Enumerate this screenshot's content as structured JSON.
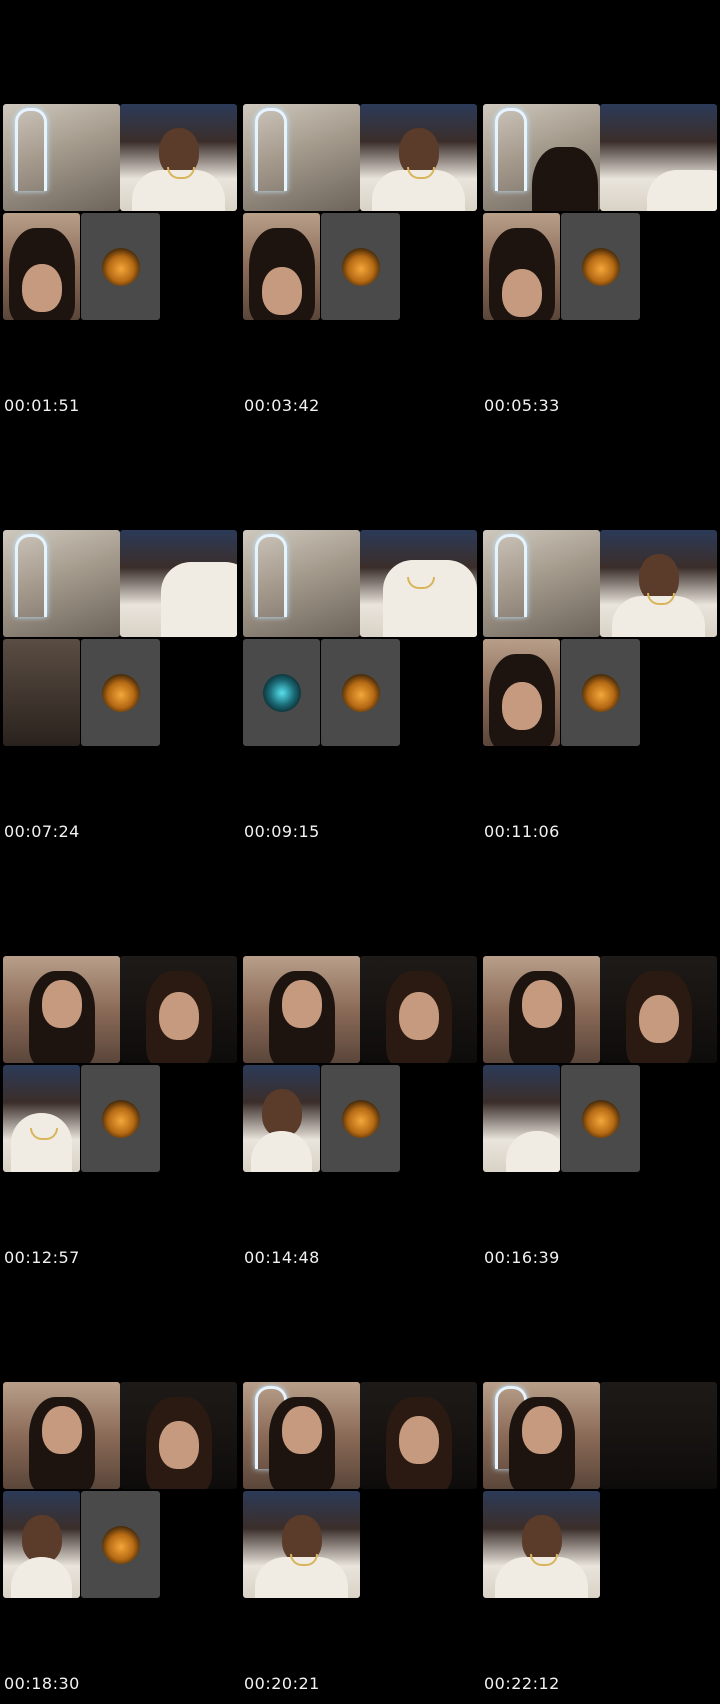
{
  "video": {
    "frames": [
      {
        "timestamp": "00:01:51",
        "tile_count": 4
      },
      {
        "timestamp": "00:03:42",
        "tile_count": 4
      },
      {
        "timestamp": "00:05:33",
        "tile_count": 4
      },
      {
        "timestamp": "00:07:24",
        "tile_count": 4
      },
      {
        "timestamp": "00:09:15",
        "tile_count": 4
      },
      {
        "timestamp": "00:11:06",
        "tile_count": 4
      },
      {
        "timestamp": "00:12:57",
        "tile_count": 4
      },
      {
        "timestamp": "00:14:48",
        "tile_count": 4
      },
      {
        "timestamp": "00:16:39",
        "tile_count": 4
      },
      {
        "timestamp": "00:18:30",
        "tile_count": 4
      },
      {
        "timestamp": "00:20:21",
        "tile_count": 3
      },
      {
        "timestamp": "00:22:12",
        "tile_count": 3
      }
    ]
  },
  "colors": {
    "background": "#000000",
    "timestamp_text": "#f2f2f2",
    "avatar_tile": "#4a4a4a"
  },
  "icons": {
    "avatar_orange": "profile-avatar-icon",
    "avatar_cyan": "profile-avatar-icon"
  }
}
